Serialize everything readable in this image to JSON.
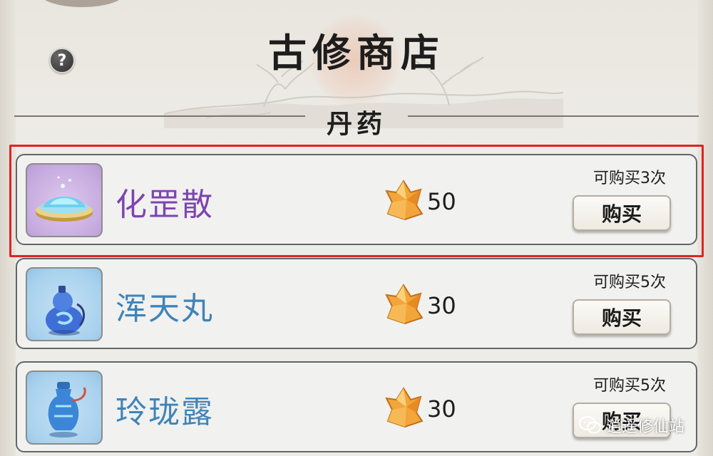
{
  "shop": {
    "title": "古修商店",
    "help_glyph": "?",
    "section": "丹药"
  },
  "currency": {
    "icon": "gold-crystal-icon"
  },
  "items": [
    {
      "name": "化罡散",
      "name_color": "#7d44b0",
      "frame": "purple",
      "icon": "powder-dish-icon",
      "price": "50",
      "limit": "可购买3次",
      "buy_label": "购买",
      "highlighted": true
    },
    {
      "name": "浑天丸",
      "name_color": "#3f84b8",
      "frame": "blue",
      "icon": "gourd-bottle-icon",
      "price": "30",
      "limit": "可购买5次",
      "buy_label": "购买",
      "highlighted": false
    },
    {
      "name": "玲珑露",
      "name_color": "#3f84b8",
      "frame": "blue",
      "icon": "vase-bottle-icon",
      "price": "30",
      "limit": "可购买5次",
      "buy_label": "购买",
      "highlighted": false
    }
  ],
  "watermark": {
    "text": "逍遥修仙站",
    "icon": "wechat-icon"
  },
  "colors": {
    "highlight": "#e02323",
    "purple_name": "#7d44b0",
    "blue_name": "#3f84b8"
  }
}
